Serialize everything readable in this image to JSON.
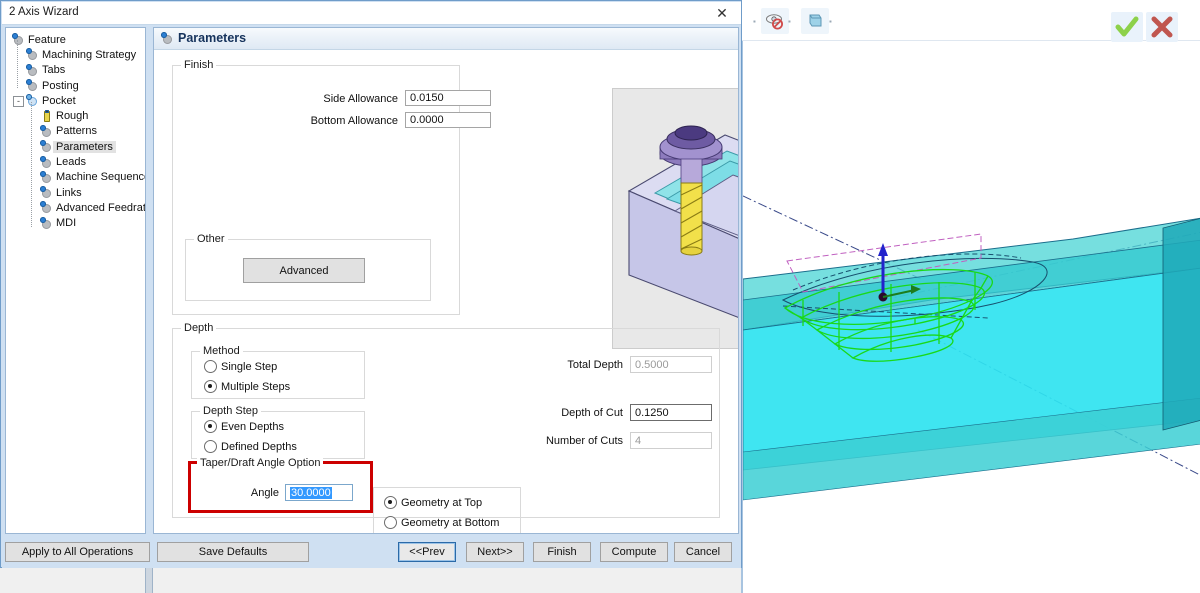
{
  "window": {
    "title": "2 Axis Wizard",
    "close_label": "✕"
  },
  "tree": {
    "items": [
      {
        "label": "Feature",
        "icon": "gear-icon",
        "depth": 0,
        "selected": false,
        "expander": null
      },
      {
        "label": "Machining Strategy",
        "icon": "gear-icon",
        "depth": 1,
        "selected": false,
        "expander": null
      },
      {
        "label": "Tabs",
        "icon": "gear-icon",
        "depth": 1,
        "selected": false,
        "expander": null
      },
      {
        "label": "Posting",
        "icon": "gear-icon",
        "depth": 1,
        "selected": false,
        "expander": null
      },
      {
        "label": "Pocket",
        "icon": "gear-open-icon",
        "depth": 1,
        "selected": false,
        "expander": "-"
      },
      {
        "label": "Rough",
        "icon": "rough-icon",
        "depth": 2,
        "selected": false,
        "expander": null
      },
      {
        "label": "Patterns",
        "icon": "gear-icon",
        "depth": 2,
        "selected": false,
        "expander": null
      },
      {
        "label": "Parameters",
        "icon": "gear-icon",
        "depth": 2,
        "selected": true,
        "expander": null
      },
      {
        "label": "Leads",
        "icon": "gear-icon",
        "depth": 2,
        "selected": false,
        "expander": null
      },
      {
        "label": "Machine Sequence",
        "icon": "gear-icon",
        "depth": 2,
        "selected": false,
        "expander": null
      },
      {
        "label": "Links",
        "icon": "gear-icon",
        "depth": 2,
        "selected": false,
        "expander": null
      },
      {
        "label": "Advanced Feedrates",
        "icon": "gear-icon",
        "depth": 2,
        "selected": false,
        "expander": null
      },
      {
        "label": "MDI",
        "icon": "gear-icon",
        "depth": 2,
        "selected": false,
        "expander": null
      }
    ]
  },
  "panel": {
    "title": "Parameters",
    "finish": {
      "legend": "Finish",
      "side_allowance_label": "Side Allowance",
      "side_allowance_value": "0.0150",
      "bottom_allowance_label": "Bottom Allowance",
      "bottom_allowance_value": "0.0000"
    },
    "other": {
      "legend": "Other",
      "advanced_label": "Advanced"
    },
    "preview": {
      "alt": "pocket-milling-illustration"
    },
    "depth": {
      "legend": "Depth",
      "method": {
        "legend": "Method",
        "options": [
          {
            "label": "Single Step",
            "selected": false
          },
          {
            "label": "Multiple Steps",
            "selected": true
          }
        ]
      },
      "depth_step": {
        "legend": "Depth Step",
        "options": [
          {
            "label": "Even Depths",
            "selected": true
          },
          {
            "label": "Defined Depths",
            "selected": false
          }
        ]
      },
      "taper": {
        "legend": "Taper/Draft Angle Option",
        "angle_label": "Angle",
        "angle_value": "30.0000",
        "angle_selected": true,
        "highlight_color": "#cc0000"
      },
      "geometry": {
        "options": [
          {
            "label": "Geometry at Top",
            "selected": true
          },
          {
            "label": "Geometry at Bottom",
            "selected": false
          }
        ]
      },
      "total_depth_label": "Total Depth",
      "total_depth_value": "0.5000",
      "total_depth_disabled": true,
      "depth_of_cut_label": "Depth of Cut",
      "depth_of_cut_value": "0.1250",
      "depth_of_cut_disabled": false,
      "number_of_cuts_label": "Number of Cuts",
      "number_of_cuts_value": "4",
      "number_of_cuts_disabled": true
    }
  },
  "buttons": {
    "apply_all": "Apply to All Operations",
    "save_defaults": "Save Defaults",
    "prev": "<<Prev",
    "next": "Next>>",
    "finish": "Finish",
    "compute": "Compute",
    "cancel": "Cancel",
    "focused": "prev"
  },
  "toolbar": {
    "hide_icon": "eye-hide-icon",
    "shade_icon": "shaded-solid-icon",
    "accept_icon": "green-check-icon",
    "reject_icon": "red-x-icon"
  },
  "colors": {
    "dialog_frame": "#cfe0f2",
    "accent": "#2b7fd4",
    "highlight_red": "#cc0000",
    "selection_blue": "#3399ff",
    "stock_cyan": "#2fe3f0",
    "toolpath_green": "#19d919"
  }
}
